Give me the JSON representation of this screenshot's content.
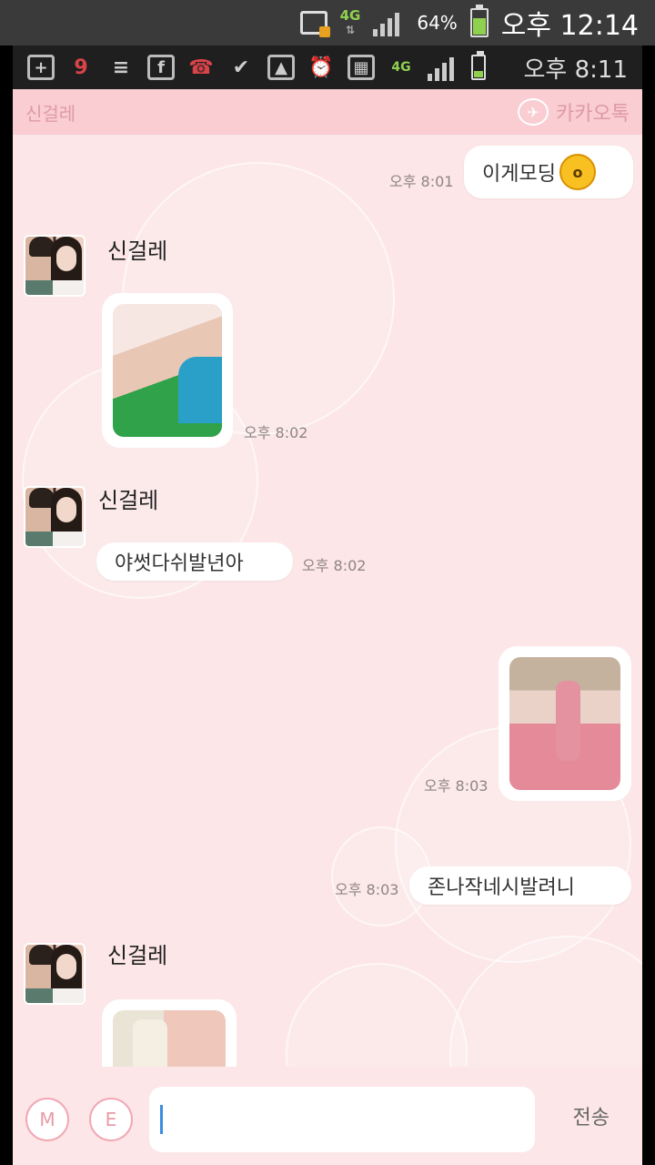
{
  "system_status": {
    "network": "4G",
    "battery": "64%",
    "battery_level": 0.64,
    "time": "오후 12:14"
  },
  "notification_bar": {
    "badge_count": "9",
    "network": "4G",
    "time": "오후 8:11"
  },
  "header": {
    "title": "신걸레",
    "brand": "카카오톡"
  },
  "messages": [
    {
      "side": "me",
      "type": "text",
      "text": "이게모딩",
      "time": "오후 8:01"
    },
    {
      "side": "other",
      "sender": "신걸레",
      "type": "image",
      "time": "오후 8:02"
    },
    {
      "side": "other",
      "sender": "신걸레",
      "type": "text",
      "text": "야썻다쉬발년아",
      "time": "오후 8:02"
    },
    {
      "side": "me",
      "type": "image",
      "time": "오후 8:03"
    },
    {
      "side": "me",
      "type": "text",
      "text": "존나작네시발려니",
      "time": "오후 8:03"
    },
    {
      "side": "other",
      "sender": "신걸레",
      "type": "image",
      "time": ""
    }
  ],
  "input_bar": {
    "m_button": "M",
    "e_button": "E",
    "input_value": "",
    "send_label": "전송"
  },
  "icons": [
    "add-icon",
    "bow-icon",
    "list-icon",
    "facebook-icon",
    "missed-call-icon",
    "check-icon",
    "gallery-icon",
    "alarm-icon",
    "signal-icon",
    "battery-icon",
    "emoji-icon"
  ],
  "colors": {
    "background": "#fce6e7",
    "header": "#f9cdd2",
    "bubble": "#ffffff",
    "network_green": "#8fd14f"
  }
}
